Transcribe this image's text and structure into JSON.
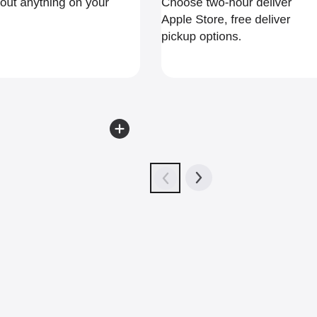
{
  "cards": {
    "left": {
      "text_lines": [
        "out anything on your"
      ]
    },
    "right": {
      "text_lines": [
        "Choose two-hour deliver",
        "Apple Store, free deliver",
        "pickup options."
      ]
    }
  },
  "icons": {
    "plus_button": "plus-icon",
    "prev": "chevron-left-icon",
    "next": "chevron-right-icon"
  },
  "colors": {
    "background": "#f5f5f7",
    "card": "#ffffff",
    "text": "#1d1d1f",
    "plus_button": "#333336",
    "nav_button": "#e8e8ed",
    "focus_ring": "#1d1d1f"
  }
}
